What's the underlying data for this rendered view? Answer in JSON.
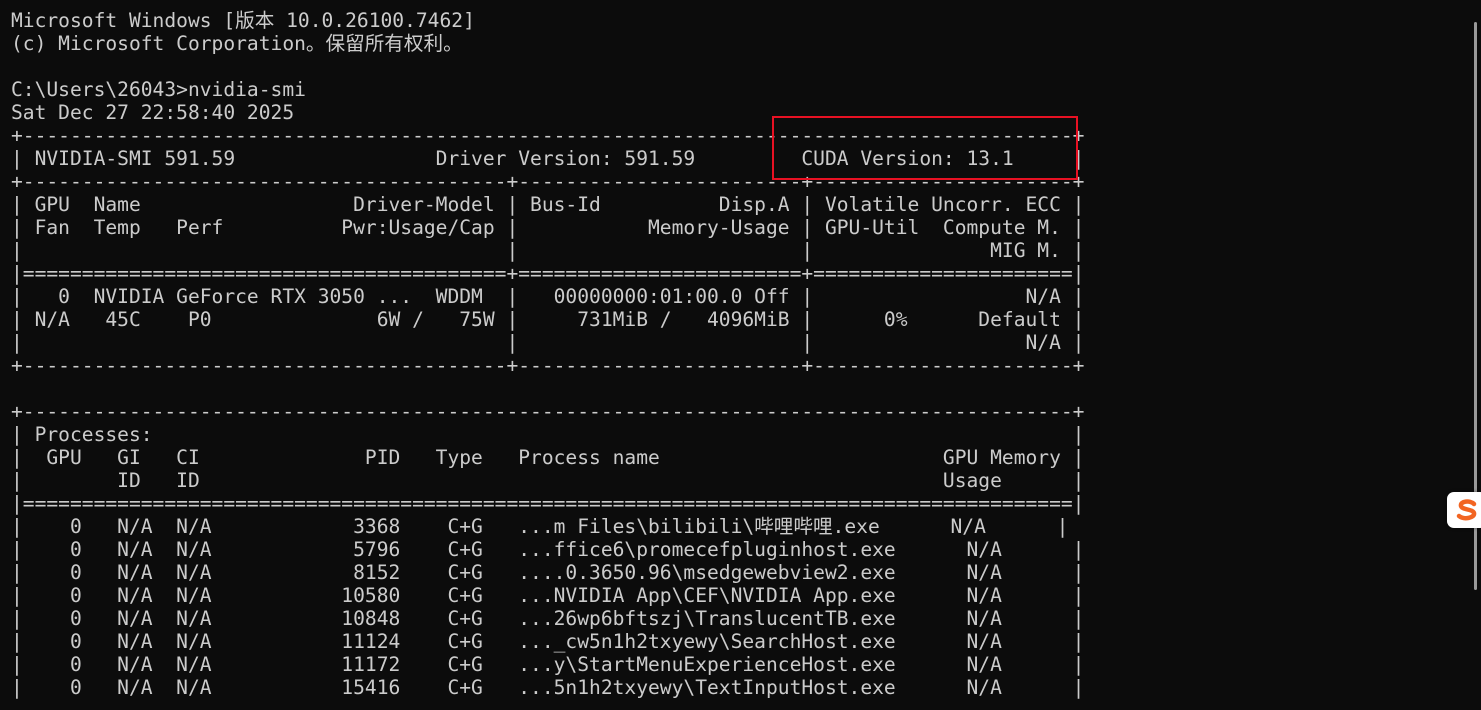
{
  "terminal": {
    "lines": [
      "Microsoft Windows [版本 10.0.26100.7462]",
      "(c) Microsoft Corporation。保留所有权利。",
      "",
      "C:\\Users\\26043>nvidia-smi",
      "Sat Dec 27 22:58:40 2025",
      "+-----------------------------------------------------------------------------------------+",
      "| NVIDIA-SMI 591.59                 Driver Version: 591.59         CUDA Version: 13.1     |",
      "+-----------------------------------------+------------------------+----------------------+",
      "| GPU  Name                  Driver-Model | Bus-Id          Disp.A | Volatile Uncorr. ECC |",
      "| Fan  Temp   Perf          Pwr:Usage/Cap |           Memory-Usage | GPU-Util  Compute M. |",
      "|                                         |                        |               MIG M. |",
      "|=========================================+========================+======================|",
      "|   0  NVIDIA GeForce RTX 3050 ...  WDDM  |   00000000:01:00.0 Off |                  N/A |",
      "| N/A   45C    P0              6W /   75W |     731MiB /   4096MiB |      0%      Default |",
      "|                                         |                        |                  N/A |",
      "+-----------------------------------------+------------------------+----------------------+",
      "",
      "+-----------------------------------------------------------------------------------------+",
      "| Processes:                                                                              |",
      "|  GPU   GI   CI              PID   Type   Process name                        GPU Memory |",
      "|        ID   ID                                                               Usage      |",
      "|=========================================================================================|",
      "|    0   N/A  N/A            3368    C+G   ...m Files\\bilibili\\哔哩哔哩.exe      N/A      |",
      "|    0   N/A  N/A            5796    C+G   ...ffice6\\promecefpluginhost.exe      N/A      |",
      "|    0   N/A  N/A            8152    C+G   ....0.3650.96\\msedgewebview2.exe      N/A      |",
      "|    0   N/A  N/A           10580    C+G   ...NVIDIA App\\CEF\\NVIDIA App.exe      N/A      |",
      "|    0   N/A  N/A           10848    C+G   ...26wp6bftszj\\TranslucentTB.exe      N/A      |",
      "|    0   N/A  N/A           11124    C+G   ..._cw5n1h2txyewy\\SearchHost.exe      N/A      |",
      "|    0   N/A  N/A           11172    C+G   ...y\\StartMenuExperienceHost.exe      N/A      |",
      "|    0   N/A  N/A           15416    C+G   ...5n1h2txyewy\\TextInputHost.exe      N/A      |"
    ]
  },
  "ime_badge": {
    "icon": "sogou-ime-icon"
  },
  "colors": {
    "background": "#0c0c0c",
    "text": "#cccccc",
    "highlight_border": "#e81123",
    "ime_accent": "#f26522"
  }
}
